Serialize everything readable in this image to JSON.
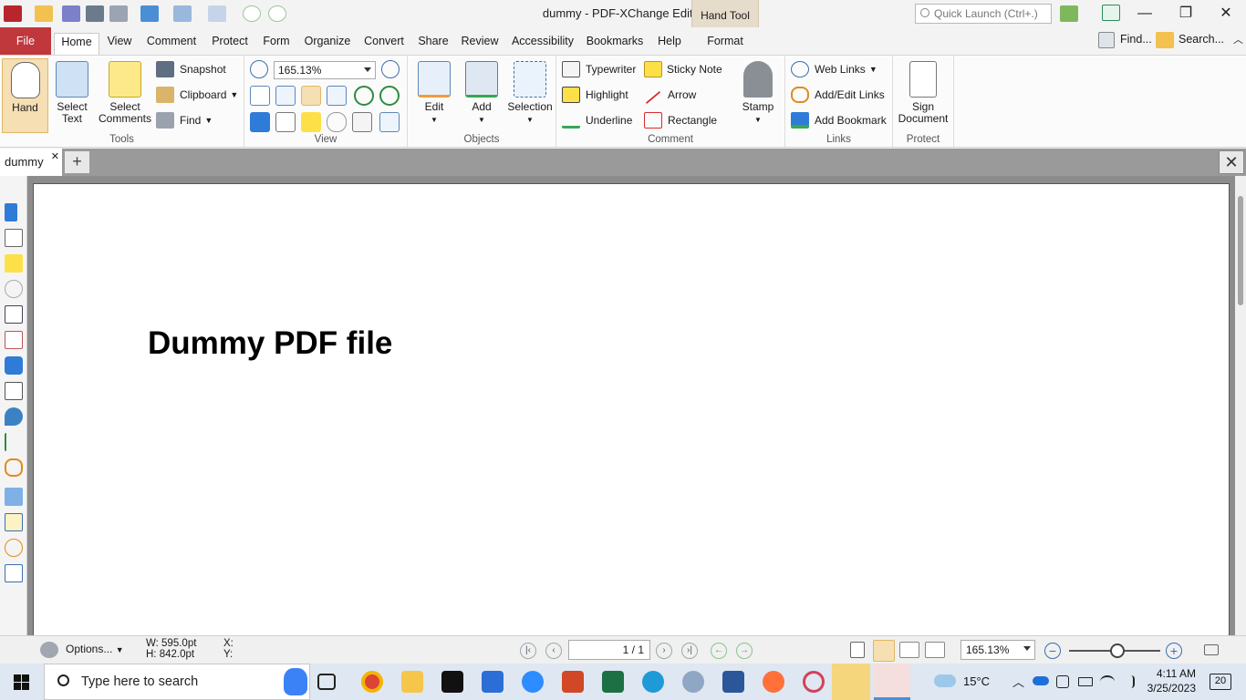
{
  "window": {
    "title": "dummy - PDF-XChange Editor",
    "context_group": "Hand Tool",
    "quick_launch_placeholder": "Quick Launch (Ctrl+.)",
    "minimize": "—",
    "maximize": "❐",
    "close": "✕"
  },
  "menu": {
    "file": "File",
    "tabs": [
      "Home",
      "View",
      "Comment",
      "Protect",
      "Form",
      "Organize",
      "Convert",
      "Share",
      "Review",
      "Accessibility",
      "Bookmarks",
      "Help",
      "Format"
    ],
    "find": "Find...",
    "search": "Search..."
  },
  "ribbon": {
    "tools": {
      "label": "Tools",
      "hand": "Hand",
      "select_text_1": "Select",
      "select_text_2": "Text",
      "select_comments_1": "Select",
      "select_comments_2": "Comments",
      "snapshot": "Snapshot",
      "clipboard": "Clipboard",
      "find": "Find"
    },
    "view": {
      "label": "View",
      "zoom": "165.13%"
    },
    "objects": {
      "label": "Objects",
      "edit": "Edit",
      "add": "Add",
      "selection": "Selection"
    },
    "comment": {
      "label": "Comment",
      "typewriter": "Typewriter",
      "sticky_note": "Sticky Note",
      "highlight": "Highlight",
      "arrow": "Arrow",
      "underline": "Underline",
      "rectangle": "Rectangle",
      "stamp": "Stamp"
    },
    "links": {
      "label": "Links",
      "web_links": "Web Links",
      "add_edit_links": "Add/Edit Links",
      "add_bookmark": "Add Bookmark"
    },
    "protect": {
      "label": "Protect",
      "sign_1": "Sign",
      "sign_2": "Document"
    }
  },
  "document": {
    "tab": "dummy",
    "heading": "Dummy PDF file"
  },
  "statusbar": {
    "options": "Options...",
    "width": "W: 595.0pt",
    "height": "H: 842.0pt",
    "x": "X:",
    "y": "Y:",
    "page": "1 / 1",
    "zoom": "165.13%"
  },
  "taskbar": {
    "search_placeholder": "Type here to search",
    "weather": "15°C",
    "time": "4:11 AM",
    "date": "3/25/2023",
    "notifications": "20"
  }
}
